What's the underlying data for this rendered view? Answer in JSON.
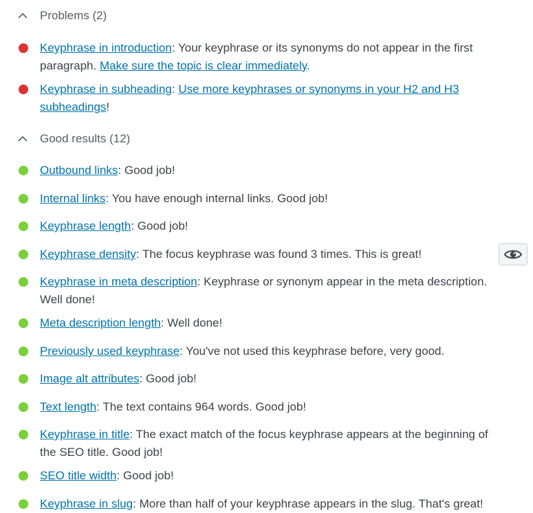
{
  "colors": {
    "problem": "#dc3232",
    "good": "#7ad03a",
    "link": "#0073aa"
  },
  "problems": {
    "header": "Problems (2)",
    "items": [
      {
        "link": "Keyphrase in introduction",
        "text1": ": Your keyphrase or its synonyms do not appear in the first paragraph. ",
        "link2": "Make sure the topic is clear immediately",
        "text2": "."
      },
      {
        "link": "Keyphrase in subheading",
        "text1": ": ",
        "link2": "Use more keyphrases or synonyms in your H2 and H3 subheadings",
        "text2": "!"
      }
    ]
  },
  "good": {
    "header": "Good results (12)",
    "items": [
      {
        "link": "Outbound links",
        "text": ": Good job!"
      },
      {
        "link": "Internal links",
        "text": ": You have enough internal links. Good job!"
      },
      {
        "link": "Keyphrase length",
        "text": ": Good job!"
      },
      {
        "link": "Keyphrase density",
        "text": ": The focus keyphrase was found 3 times. This is great!"
      },
      {
        "link": "Keyphrase in meta description",
        "text": ": Keyphrase or synonym appear in the meta description. Well done!"
      },
      {
        "link": "Meta description length",
        "text": ": Well done!"
      },
      {
        "link": "Previously used keyphrase",
        "text": ": You've not used this keyphrase before, very good."
      },
      {
        "link": "Image alt attributes",
        "text": ": Good job!"
      },
      {
        "link": "Text length",
        "text": ": The text contains 964 words. Good job!"
      },
      {
        "link": "Keyphrase in title",
        "text": ": The exact match of the focus keyphrase appears at the beginning of the SEO title. Good job!"
      },
      {
        "link": "SEO title width",
        "text": ": Good job!"
      },
      {
        "link": "Keyphrase in slug",
        "text": ": More than half of your keyphrase appears in the slug. That's great!"
      }
    ]
  },
  "eye_button": {
    "icon": "eye-icon"
  }
}
